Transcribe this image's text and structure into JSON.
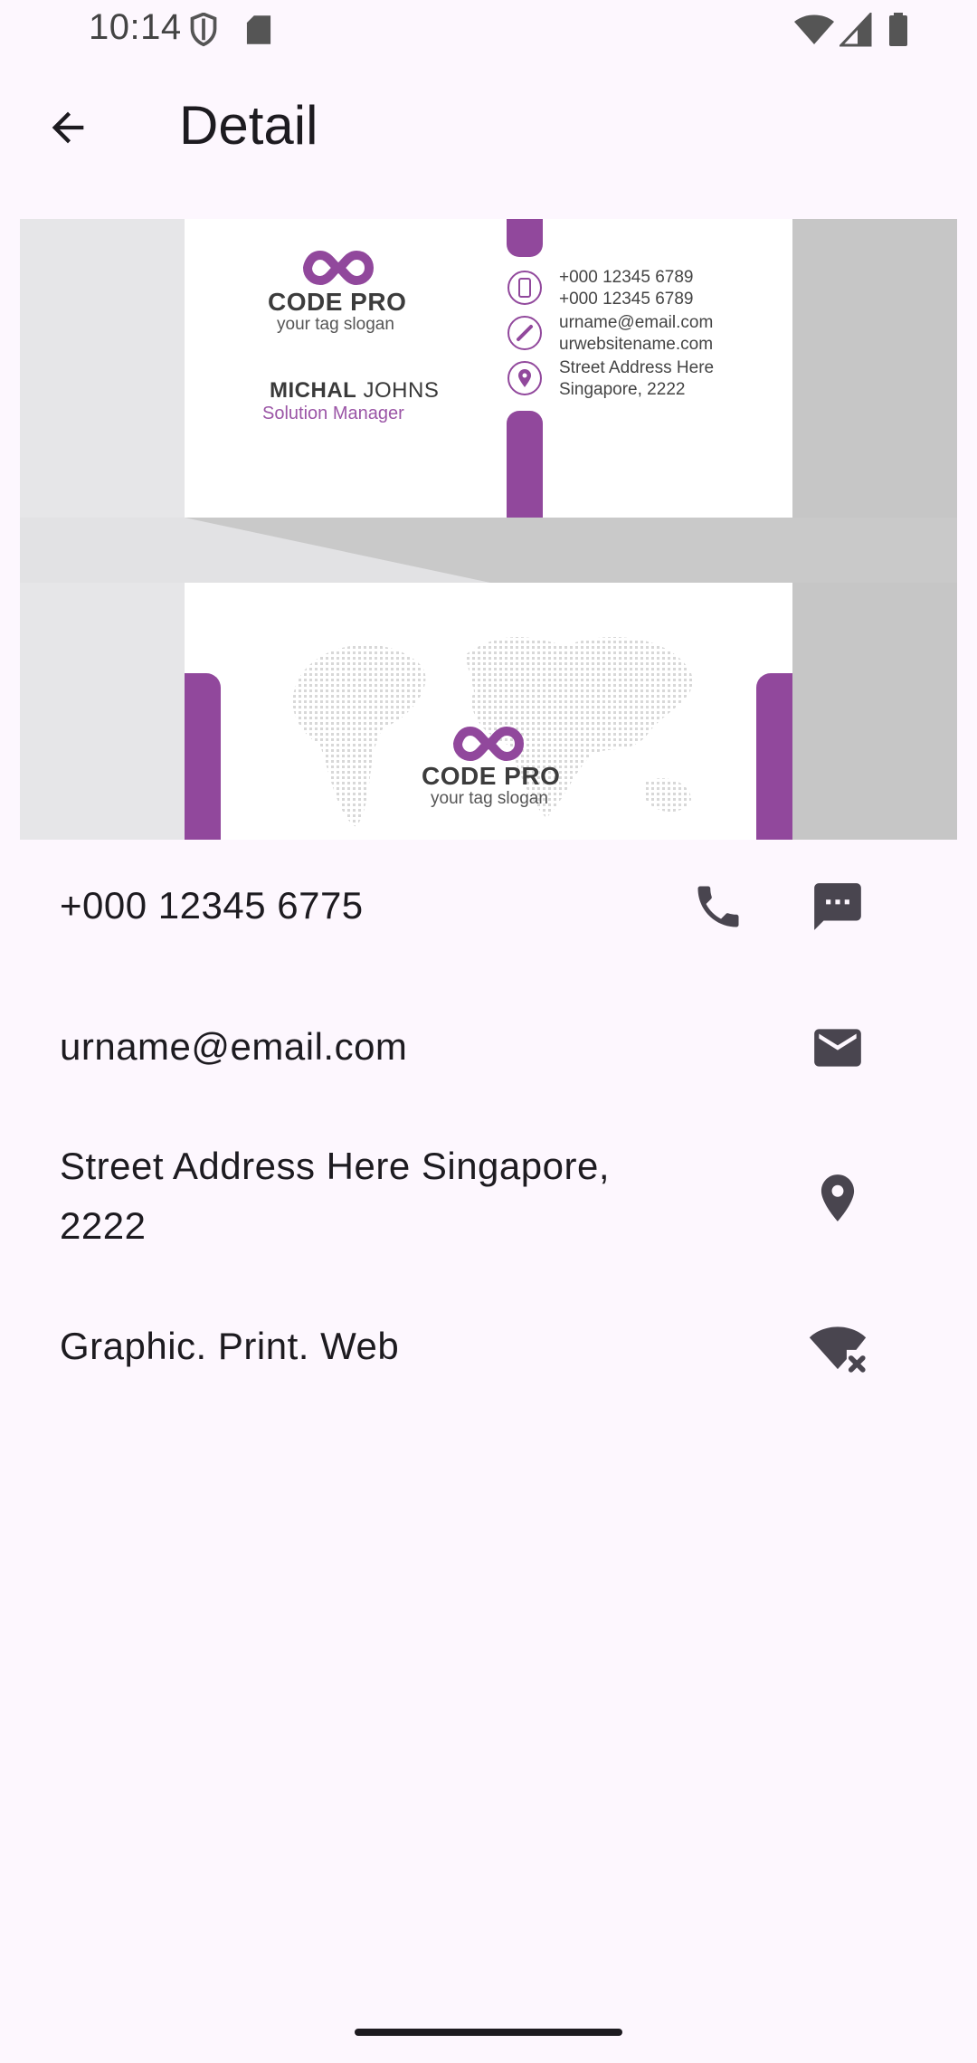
{
  "status_bar": {
    "time": "10:14",
    "icons": [
      "shield-icon",
      "sd-card-icon",
      "wifi-icon",
      "signal-icon",
      "battery-icon"
    ]
  },
  "app_bar": {
    "title": "Detail",
    "back_icon": "arrow-back-icon"
  },
  "business_card": {
    "logo_text": "CODE PRO",
    "slogan": "your tag slogan",
    "name_first": "MICHAL",
    "name_last": "JOHNS",
    "role": "Solution Manager",
    "phone_1": "+000 12345 6789",
    "phone_2": "+000 12345 6789",
    "email": "urname@email.com",
    "website": "urwebsitename.com",
    "address_line_1": "Street Address Here",
    "address_line_2": "Singapore, 2222",
    "accent_color": "#91489C"
  },
  "details": {
    "phone": "+000 12345 6775",
    "email": "urname@email.com",
    "address": "Street Address Here Singapore, 2222",
    "website": "Graphic. Print. Web"
  },
  "colors": {
    "background": "#FDF7FE",
    "icon": "#49454F",
    "accent": "#91489C"
  }
}
